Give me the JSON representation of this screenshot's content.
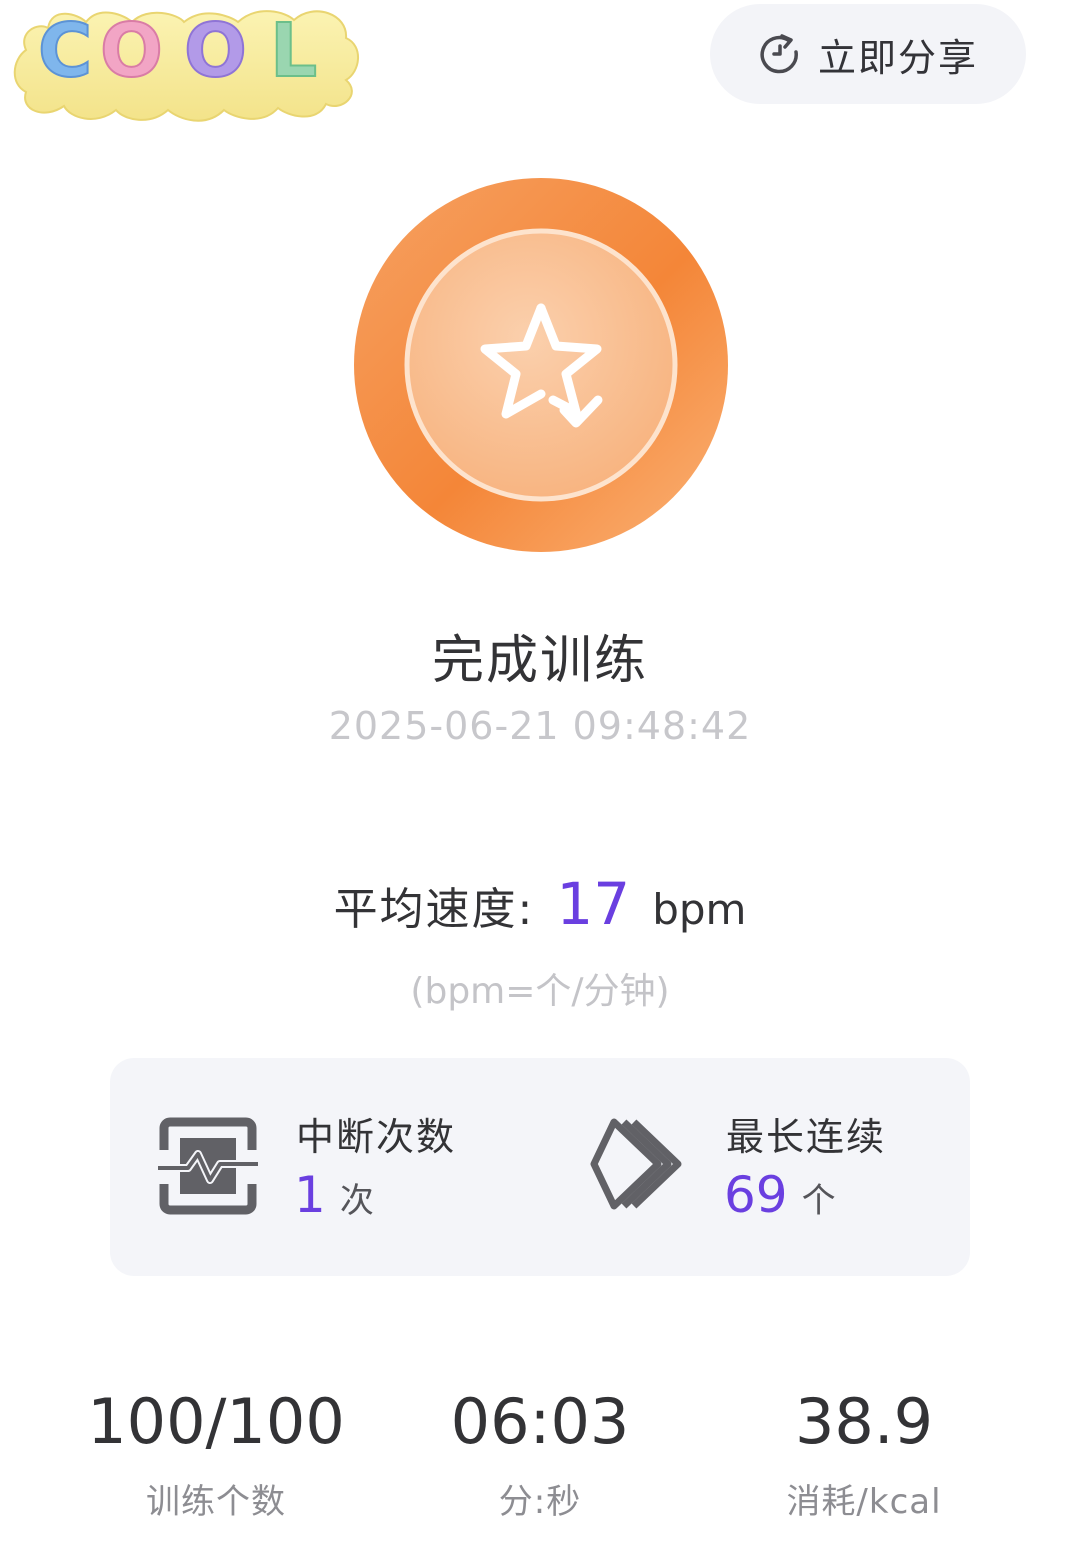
{
  "sticker": {
    "text": "COOL"
  },
  "header": {
    "share_label": "立即分享",
    "share_icon": "share-refresh-icon"
  },
  "medal": {
    "icon": "star-check-icon",
    "colors": {
      "outer": "#f58a3c",
      "inner": "#f9bd8e"
    }
  },
  "summary": {
    "title": "完成训练",
    "timestamp": "2025-06-21 09:48:42"
  },
  "speed": {
    "label": "平均速度:",
    "value": "17",
    "unit": "bpm",
    "note": "(bpm=个/分钟)"
  },
  "stats": {
    "interrupts": {
      "label": "中断次数",
      "value": "1",
      "unit": "次",
      "icon": "interrupt-wave-icon"
    },
    "longest_streak": {
      "label": "最长连续",
      "value": "69",
      "unit": "个",
      "icon": "stacked-diamonds-icon"
    }
  },
  "metrics": [
    {
      "value": "100/100",
      "label": "训练个数"
    },
    {
      "value": "06:03",
      "label": "分:秒"
    },
    {
      "value": "38.9",
      "label": "消耗/kcal"
    }
  ],
  "colors": {
    "accent": "#6a3fe0",
    "card_bg": "#f4f5f9",
    "medal_orange": "#f58a3c"
  }
}
